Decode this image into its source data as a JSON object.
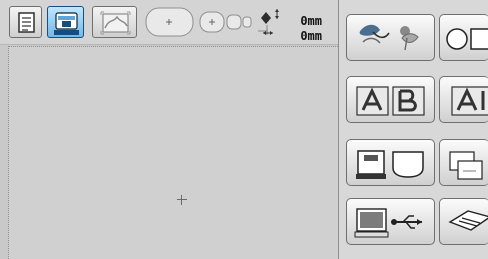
{
  "status": {
    "height_readout": "0mm",
    "width_readout": "0mm"
  },
  "toolbar": {
    "buttons": [
      {
        "name": "page-view",
        "selected": false
      },
      {
        "name": "embroidery-machine",
        "selected": true
      },
      {
        "name": "pattern-preview",
        "selected": false
      }
    ]
  },
  "menu": {
    "items": [
      "embroidery-patterns",
      "frame-patterns",
      "alphabet",
      "alphabet-more",
      "machine-memory",
      "pocket-memory",
      "computer-usb",
      "card-reader"
    ]
  },
  "colors": {
    "accent": "#7fc4f0",
    "button_border": "#6f6f6f",
    "field": "#d0d0d0"
  }
}
